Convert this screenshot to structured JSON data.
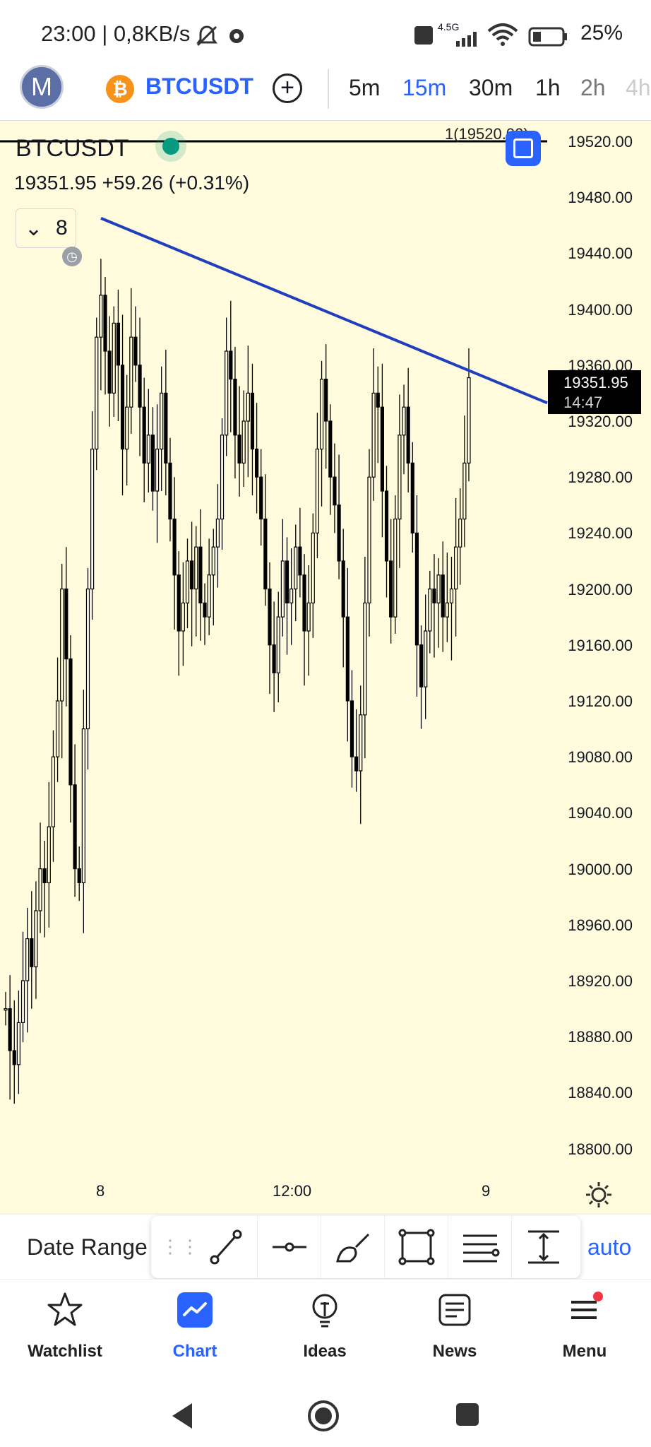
{
  "status_bar": {
    "time": "23:00 | 0,8KB/s",
    "network": "4.5G",
    "battery": "25%"
  },
  "header": {
    "avatar_letter": "M",
    "symbol": "BTCUSDT",
    "btc_icon": "bitcoin-icon",
    "timeframes": [
      "5m",
      "15m",
      "30m",
      "1h",
      "2h",
      "4h"
    ],
    "active_timeframe": "15m"
  },
  "chart": {
    "legend_symbol": "BTCUSDT",
    "legend_price": "19351.95  +59.26 (+0.31%)",
    "indicator_count": "8",
    "hline_label": "1(19520.00)",
    "price_tag": {
      "price": "19351.95",
      "countdown": "14:47"
    },
    "y_ticks": [
      "19520.00",
      "19480.00",
      "19440.00",
      "19400.00",
      "19360.00",
      "19320.00",
      "19280.00",
      "19240.00",
      "19200.00",
      "19160.00",
      "19120.00",
      "19080.00",
      "19040.00",
      "19000.00",
      "18960.00",
      "18920.00",
      "18880.00",
      "18840.00",
      "18800.00"
    ],
    "x_ticks": [
      "8",
      "12:00",
      "9"
    ],
    "colors": {
      "background": "#fffbdc",
      "trendline": "#1f3fbf",
      "hline": "#000000",
      "candle": "#000000"
    }
  },
  "chart_data": {
    "type": "candlestick",
    "symbol": "BTCUSDT",
    "interval": "15m",
    "ylim": [
      18800,
      19520
    ],
    "x_labels": [
      "8",
      "12:00",
      "9"
    ],
    "last_price": 19351.95,
    "change": 59.26,
    "change_pct": 0.31,
    "horizontal_line": 19520.0,
    "trendline": {
      "from_price": 19465,
      "to_price": 19333
    },
    "closes": [
      18900,
      18870,
      18860,
      18890,
      18920,
      18950,
      18930,
      18970,
      19000,
      18990,
      19030,
      19080,
      19120,
      19200,
      19150,
      19060,
      19000,
      18990,
      19100,
      19200,
      19300,
      19380,
      19410,
      19370,
      19340,
      19390,
      19360,
      19300,
      19330,
      19380,
      19360,
      19330,
      19290,
      19310,
      19270,
      19300,
      19340,
      19290,
      19250,
      19210,
      19170,
      19190,
      19220,
      19200,
      19230,
      19190,
      19180,
      19210,
      19230,
      19250,
      19310,
      19370,
      19350,
      19310,
      19290,
      19320,
      19340,
      19300,
      19280,
      19250,
      19200,
      19160,
      19140,
      19180,
      19220,
      19190,
      19200,
      19230,
      19210,
      19170,
      19190,
      19240,
      19300,
      19350,
      19320,
      19280,
      19260,
      19220,
      19180,
      19120,
      19080,
      19070,
      19110,
      19190,
      19280,
      19340,
      19330,
      19270,
      19220,
      19180,
      19250,
      19310,
      19330,
      19290,
      19240,
      19160,
      19130,
      19170,
      19200,
      19190,
      19210,
      19180,
      19190,
      19200,
      19230,
      19250,
      19290,
      19351
    ]
  },
  "toolbar": {
    "date_range_label": "Date Range",
    "auto_label": "auto",
    "tools": [
      "trend-line-icon",
      "horizontal-line-icon",
      "brush-icon",
      "rectangle-icon",
      "fib-retracement-icon",
      "measure-icon"
    ]
  },
  "nav": {
    "items": [
      {
        "label": "Watchlist",
        "icon": "star-icon"
      },
      {
        "label": "Chart",
        "icon": "chart-icon"
      },
      {
        "label": "Ideas",
        "icon": "lightbulb-icon"
      },
      {
        "label": "News",
        "icon": "news-icon"
      },
      {
        "label": "Menu",
        "icon": "menu-icon"
      }
    ],
    "active": "Chart"
  }
}
